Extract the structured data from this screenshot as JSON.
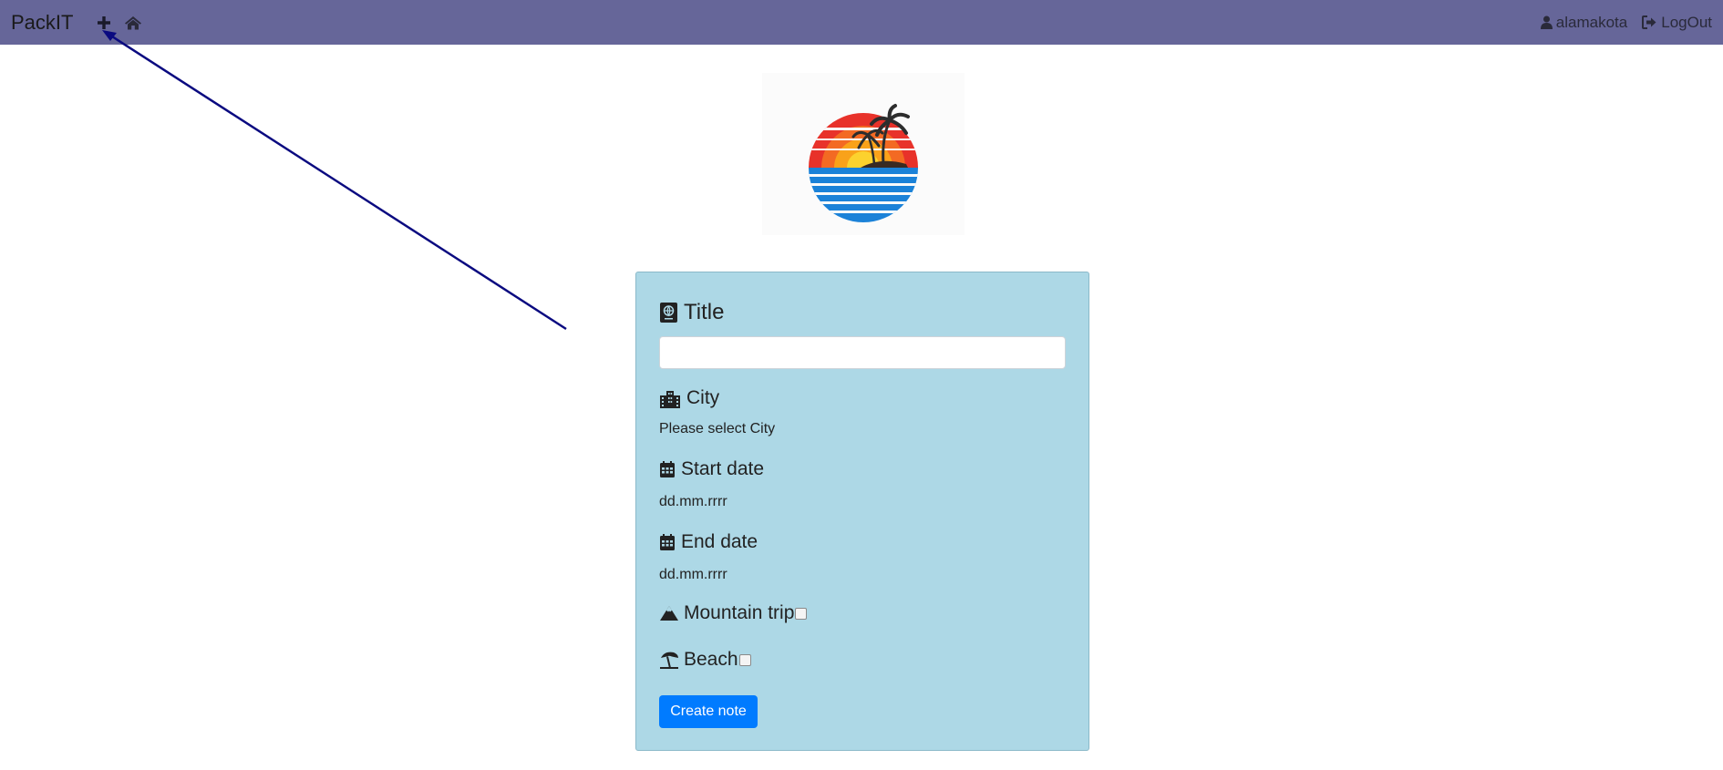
{
  "navbar": {
    "brand": "PackIT",
    "username": "alamakota",
    "logout_label": "LogOut"
  },
  "form": {
    "title_label": "Title",
    "title_value": "",
    "city_label": "City",
    "city_placeholder": "Please select City",
    "start_date_label": "Start date",
    "start_date_placeholder": "dd.mm.rrrr",
    "end_date_label": "End date",
    "end_date_placeholder": "dd.mm.rrrr",
    "mountain_label": "Mountain trip",
    "beach_label": "Beach",
    "submit_label": "Create note"
  },
  "colors": {
    "navbar": "#666699",
    "card": "#add8e6",
    "primary": "#007bff",
    "annotation_arrow": "#0a0a80"
  },
  "icons": [
    "plus-icon",
    "home-icon",
    "user-icon",
    "logout-icon",
    "passport-icon",
    "city-icon",
    "calendar-icon",
    "mountain-icon",
    "umbrella-beach-icon"
  ]
}
